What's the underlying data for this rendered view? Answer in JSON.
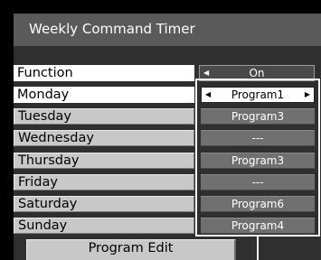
{
  "window": {
    "title": "Weekly Command Timer"
  },
  "rows": [
    {
      "label": "Function",
      "value": "On"
    },
    {
      "label": "Monday",
      "value": "Program1"
    },
    {
      "label": "Tuesday",
      "value": "Program3"
    },
    {
      "label": "Wednesday",
      "value": "---"
    },
    {
      "label": "Thursday",
      "value": "Program3"
    },
    {
      "label": "Friday",
      "value": "---"
    },
    {
      "label": "Saturday",
      "value": "Program6"
    },
    {
      "label": "Sunday",
      "value": "Program4"
    }
  ],
  "buttons": {
    "program_edit": "Program Edit"
  },
  "icons": {
    "left_arrow": "◀",
    "right_arrow": "▶"
  },
  "colors": {
    "background": "#000000",
    "panel": "#2f2f2f",
    "title_bar": "#5a5a5a",
    "label_cell": "#c8c8c8",
    "label_selected": "#ffffff",
    "value_cell": "#707070",
    "value_selected": "#ffffff",
    "frame": "#ffffff"
  }
}
